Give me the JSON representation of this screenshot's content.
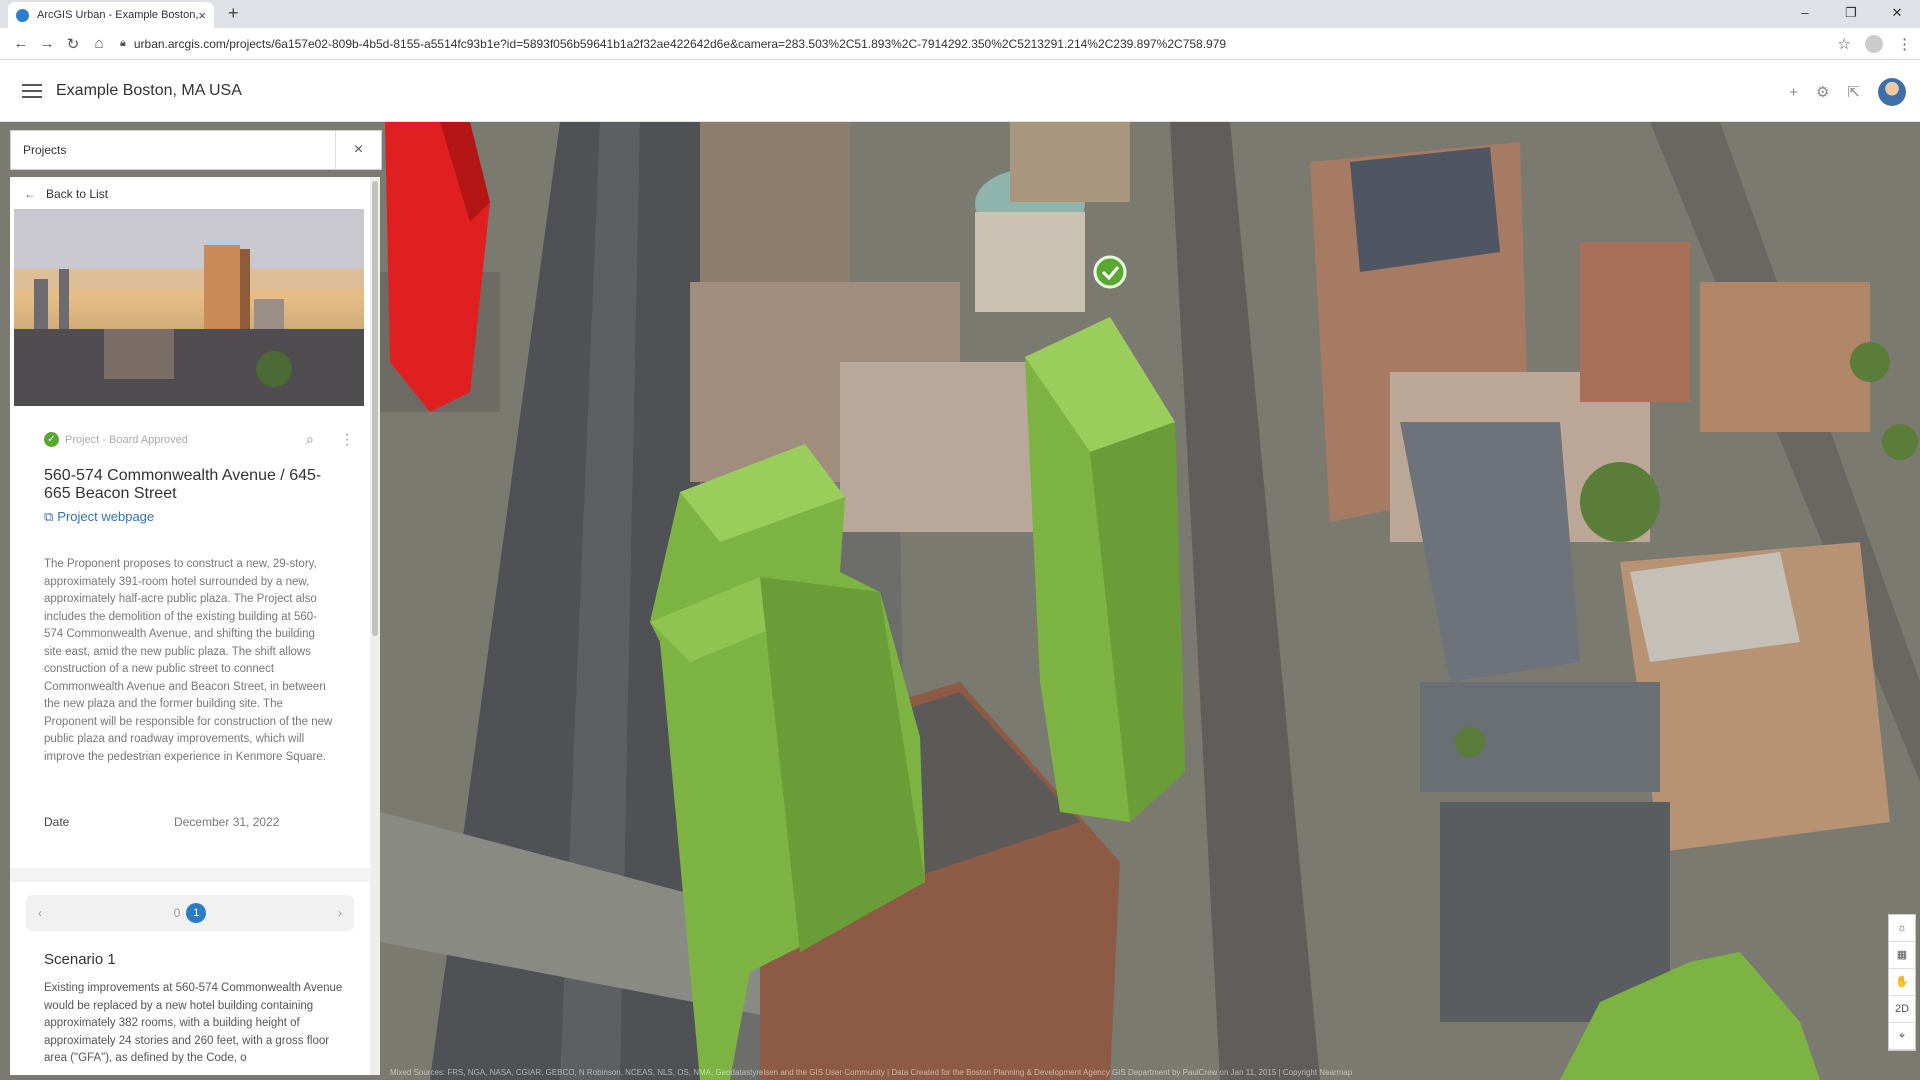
{
  "browser": {
    "tab_title": "ArcGIS Urban - Example Boston,",
    "tab_close": "×",
    "new_tab": "+",
    "url": "urban.arcgis.com/projects/6a157e02-809b-4b5d-8155-a5514fc93b1e?id=5893f056b59641b1a2f32ae422642d6e&camera=283.503%2C51.893%2C-7914292.350%2C5213291.214%2C239.897%2C758.979"
  },
  "header": {
    "title": "Example Boston, MA USA"
  },
  "search_panel": {
    "title": "Projects",
    "close": "×"
  },
  "panel": {
    "back_label": "Back to List",
    "status": "Project - Board Approved",
    "project_title": "560-574 Commonwealth Avenue / 645-665 Beacon Street",
    "link_label": "Project webpage",
    "description": "The Proponent proposes to construct a new, 29-story, approximately 391-room hotel surrounded by a new, approximately half-acre public plaza. The Project also includes the demolition of the existing building at 560-574 Commonwealth Avenue, and shifting the building site east, amid the new public plaza. The shift allows construction of a new public street to connect Commonwealth Avenue and Beacon Street, in between the new plaza and the former building site. The Proponent will be responsible for construction of the new public plaza and roadway improvements, which will improve the pedestrian experience in Kenmore Square.",
    "date_label": "Date",
    "date_value": "December 31, 2022",
    "pager": {
      "page0": "0",
      "page1": "1",
      "prev": "‹",
      "next": "›"
    },
    "scenario_title": "Scenario 1",
    "scenario_desc": "Existing improvements at 560-574 Commonwealth Avenue would be replaced by a new hotel building containing approximately 382 rooms, with a building height of approximately 24 stories and 260 feet, with a gross floor area (\"GFA\"), as defined by the Code, o"
  },
  "map_controls": [
    "☼",
    "▦",
    "✋",
    "2D",
    "⌖"
  ],
  "attribution": "Mixed Sources: FRS, NGA, NASA, CGIAR, GEBCO, N Robinson, NCEAS, NLS, OS, NMA, Geodatastyrelsen and the GIS User Community | Data Created for the Boston Planning & Development Agency GIS Department by PaulCrew on Jan 11, 2015 | Copyright Nearmap",
  "colors": {
    "proposed_building": "#7cb342",
    "existing_highlight": "#e02020",
    "accent": "#2b7ec4",
    "status_green": "#5aa832"
  }
}
